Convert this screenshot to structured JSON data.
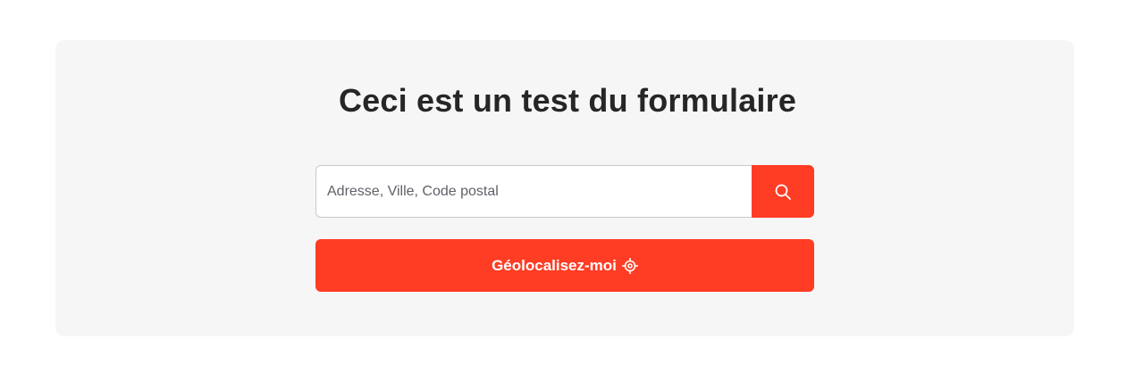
{
  "form": {
    "title": "Ceci est un test du formulaire",
    "search": {
      "placeholder": "Adresse, Ville, Code postal",
      "value": "",
      "button_icon": "search-icon"
    },
    "geolocate": {
      "label": "Géolocalisez-moi",
      "icon": "crosshair-icon"
    }
  },
  "colors": {
    "accent": "#ff3c24",
    "card_background": "#f6f6f6",
    "title_text": "#262626"
  }
}
